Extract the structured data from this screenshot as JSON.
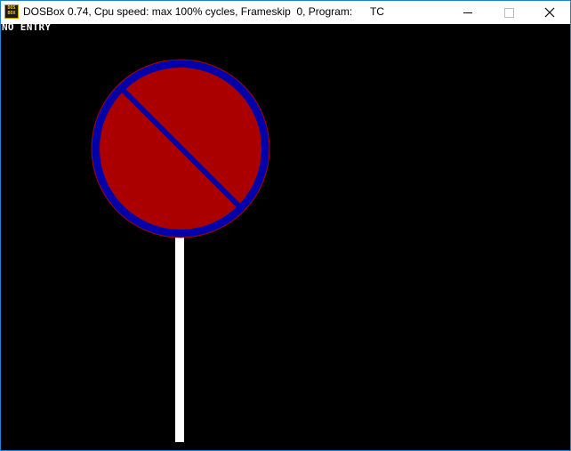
{
  "window": {
    "title": "DOSBox 0.74, Cpu speed: max 100% cycles, Frameskip  0, Program:      TC",
    "app_icon": {
      "name": "dosbox-icon",
      "line1": "DOS",
      "line2": "BOX"
    },
    "controls": {
      "minimize_icon": "minimize-icon",
      "maximize_icon": "maximize-icon",
      "close_icon": "close-icon",
      "close_glyph": "✕"
    }
  },
  "screen": {
    "label": "NO ENTRY",
    "colors": {
      "background": "#000000",
      "sign_fill": "#aa0000",
      "sign_ring": "#0000aa",
      "sign_outline": "#aa0000",
      "pole": "#ffffff",
      "text": "#ffffff"
    }
  }
}
